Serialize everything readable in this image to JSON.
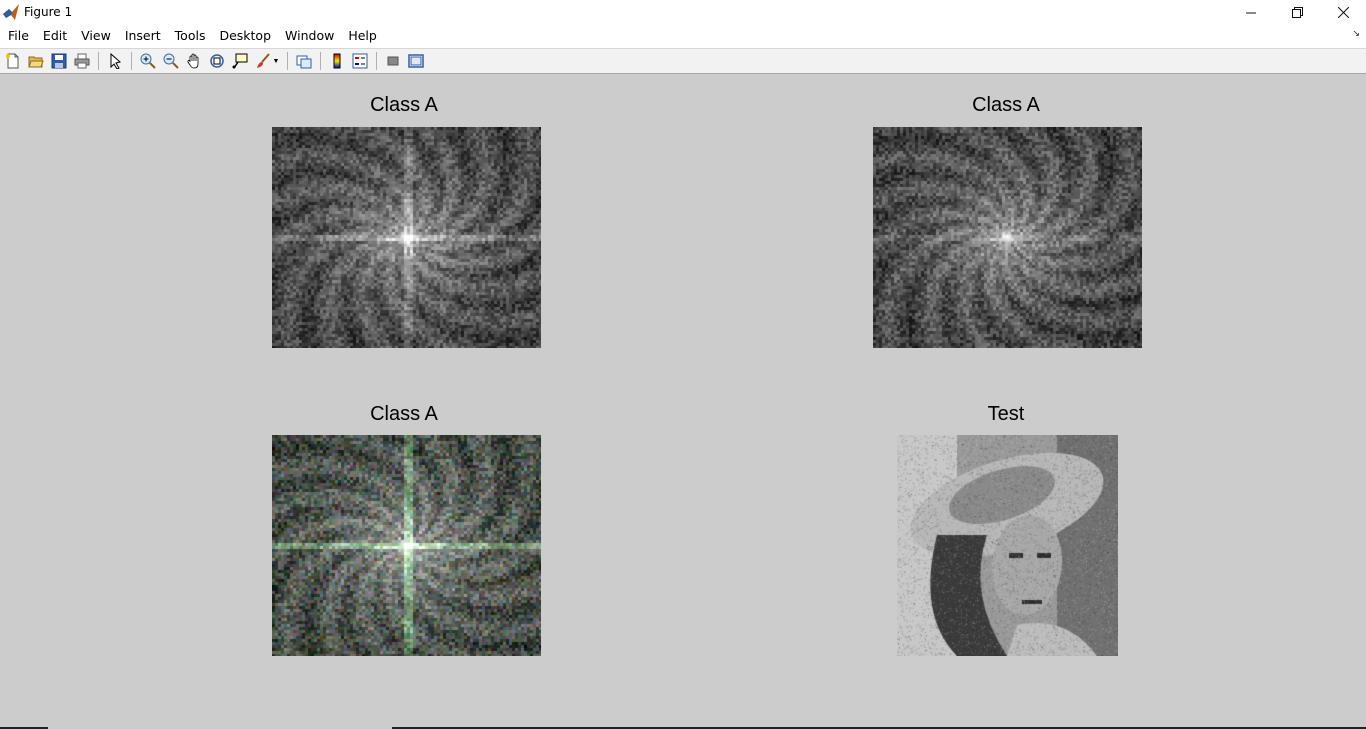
{
  "window": {
    "title": "Figure 1",
    "controls": [
      "minimize",
      "restore",
      "close"
    ]
  },
  "menu": {
    "items": [
      "File",
      "Edit",
      "View",
      "Insert",
      "Tools",
      "Desktop",
      "Window",
      "Help"
    ]
  },
  "toolbar": {
    "icons": [
      "new-figure-icon",
      "open-file-icon",
      "save-icon",
      "print-icon",
      "edit-plot-icon",
      "zoom-in-icon",
      "zoom-out-icon",
      "pan-icon",
      "rotate-3d-icon",
      "data-cursor-icon",
      "brush-icon",
      "link-plot-icon",
      "colorbar-icon",
      "legend-icon",
      "hide-plot-tools-icon",
      "show-plot-tools-icon"
    ]
  },
  "subplots": [
    {
      "title": "Class A",
      "kind": "fft-gray-cross"
    },
    {
      "title": "Class A",
      "kind": "fft-gray"
    },
    {
      "title": "Class A",
      "kind": "fft-color"
    },
    {
      "title": "Test",
      "kind": "photo-portrait"
    }
  ]
}
